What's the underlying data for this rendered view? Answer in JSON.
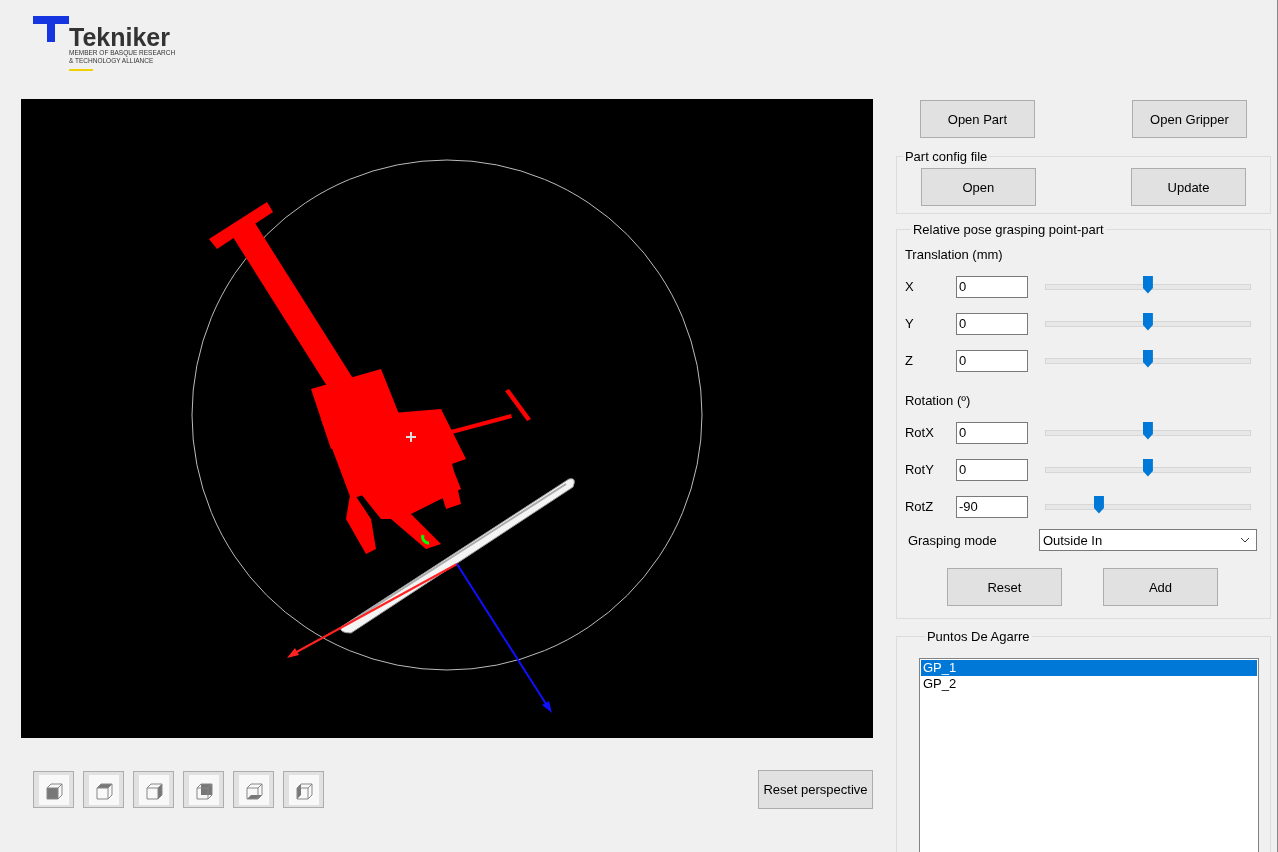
{
  "logo": {
    "name": "Tekniker",
    "tagline_1": "MEMBER OF BASQUE RESEARCH",
    "tagline_2": "& TECHNOLOGY ALLIANCE"
  },
  "top_buttons": [
    "Open Part",
    "Open Gripper"
  ],
  "part_config": {
    "title": "Part config file",
    "buttons": [
      "Open",
      "Update"
    ]
  },
  "pose": {
    "title": "Relative pose grasping point-part",
    "translation_title": "Translation (mm)",
    "translation": [
      {
        "label": "X",
        "value": "0",
        "level": 0.5
      },
      {
        "label": "Y",
        "value": "0",
        "level": 0.5
      },
      {
        "label": "Z",
        "value": "0",
        "level": 0.5
      }
    ],
    "rotation_title": "Rotation (º)",
    "rotation": [
      {
        "label": "RotX",
        "value": "0",
        "level": 0.5
      },
      {
        "label": "RotY",
        "value": "0",
        "level": 0.5
      },
      {
        "label": "RotZ",
        "value": "-90",
        "level": 0.26
      }
    ],
    "grasping_mode": {
      "label": "Grasping mode",
      "value": "Outside In"
    },
    "buttons": [
      "Reset",
      "Add"
    ]
  },
  "grasp_points": {
    "title": "Puntos De Agarre",
    "items": [
      {
        "label": "GP_1",
        "selected": true
      },
      {
        "label": "GP_2",
        "selected": false
      }
    ]
  },
  "reset_perspective": "Reset perspective"
}
